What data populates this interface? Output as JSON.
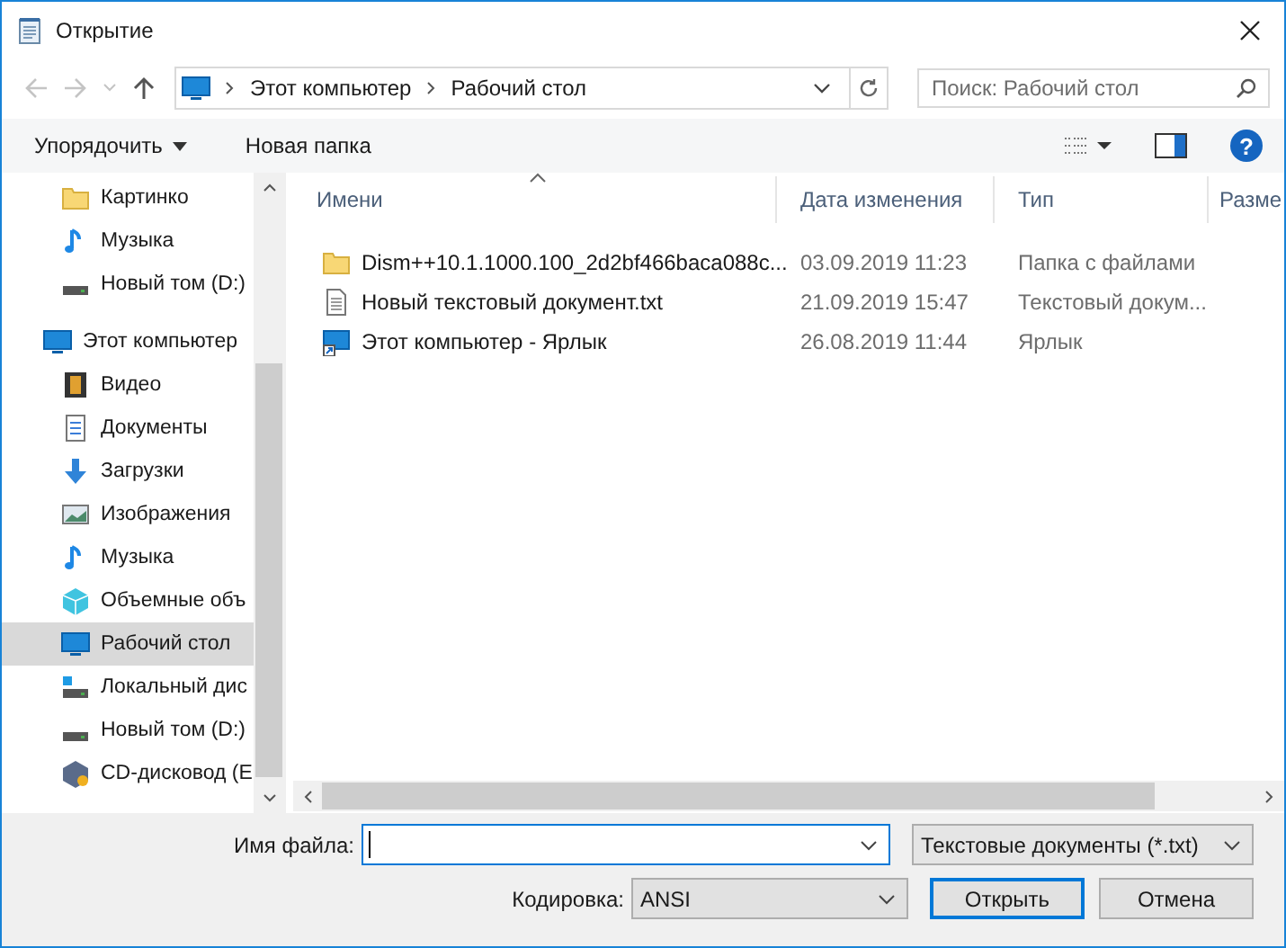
{
  "window": {
    "title": "Открытие"
  },
  "address": {
    "crumbs": [
      "Этот компьютер",
      "Рабочий стол"
    ]
  },
  "search": {
    "placeholder": "Поиск: Рабочий стол"
  },
  "toolbar": {
    "organize": "Упорядочить",
    "new_folder": "Новая папка",
    "help": "?"
  },
  "sidebar": {
    "upper_items": [
      {
        "label": "Картинко",
        "kind": "folder",
        "selected": false
      },
      {
        "label": "Музыка",
        "kind": "music",
        "selected": false
      },
      {
        "label": "Новый том (D:)",
        "kind": "drive",
        "selected": false
      }
    ],
    "tree": [
      {
        "label": "Этот компьютер",
        "kind": "computer",
        "selected": false,
        "children": [
          {
            "label": "Видео",
            "kind": "video",
            "selected": false
          },
          {
            "label": "Документы",
            "kind": "document",
            "selected": false
          },
          {
            "label": "Загрузки",
            "kind": "download",
            "selected": false
          },
          {
            "label": "Изображения",
            "kind": "picture",
            "selected": false
          },
          {
            "label": "Музыка",
            "kind": "music",
            "selected": false
          },
          {
            "label": "Объемные объ",
            "kind": "cube",
            "selected": false
          },
          {
            "label": "Рабочий стол",
            "kind": "desktop",
            "selected": true
          },
          {
            "label": "Локальный дис",
            "kind": "windrive",
            "selected": false
          },
          {
            "label": "Новый том (D:)",
            "kind": "drive",
            "selected": false
          },
          {
            "label": "CD-дисковод (E",
            "kind": "cd",
            "selected": false
          }
        ]
      }
    ]
  },
  "table": {
    "columns": [
      "Имени",
      "Дата изменения",
      "Тип",
      "Разме"
    ],
    "rows": [
      {
        "kind": "folder",
        "name": "Dism++10.1.1000.100_2d2bf466baca088c...",
        "date": "03.09.2019 11:23",
        "type": "Папка с файлами"
      },
      {
        "kind": "text",
        "name": "Новый текстовый документ.txt",
        "date": "21.09.2019 15:47",
        "type": "Текстовый докум..."
      },
      {
        "kind": "shortcut",
        "name": "Этот компьютер - Ярлык",
        "date": "26.08.2019 11:44",
        "type": "Ярлык"
      }
    ]
  },
  "footer": {
    "filename_label": "Имя файла:",
    "filter": "Текстовые документы (*.txt)",
    "encoding_label": "Кодировка:",
    "encoding": "ANSI",
    "open": "Открыть",
    "cancel": "Отмена"
  }
}
